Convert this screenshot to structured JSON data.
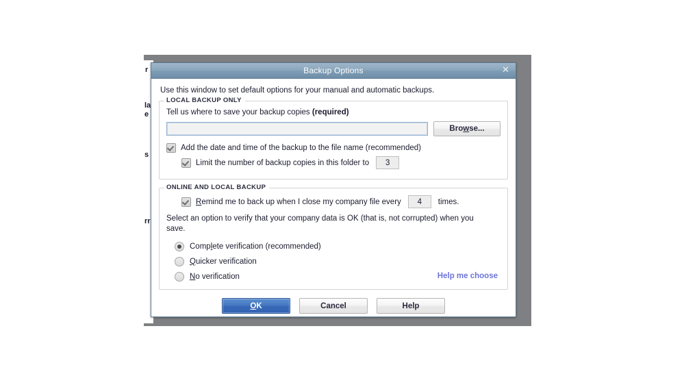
{
  "background_window": {
    "text_fragments": [
      "r",
      "la",
      "e",
      "s",
      "rr"
    ]
  },
  "dialog": {
    "title": "Backup Options",
    "close_icon": "close-icon",
    "intro": "Use this window to set default options for your manual and automatic backups.",
    "local_group": {
      "legend": "LOCAL BACKUP ONLY",
      "prompt_text": "Tell us where to save your backup copies ",
      "prompt_emphasis": "(required)",
      "path_value": "",
      "path_placeholder": "",
      "browse_label_pre": "Bro",
      "browse_label_accel": "w",
      "browse_label_post": "se...",
      "add_date_label": "Add the date and time of the backup to the file name (recommended)",
      "add_date_checked": true,
      "limit_label": "Limit the number of backup copies in this folder to",
      "limit_checked": true,
      "limit_value": "3"
    },
    "online_group": {
      "legend": "ONLINE AND LOCAL BACKUP",
      "remind_checked": true,
      "remind_label_accel": "R",
      "remind_label_rest": "emind me to back up when I close my company file every",
      "remind_value": "4",
      "remind_suffix": "times.",
      "verify_paragraph": "Select an option to verify that your company data is OK (that is, not corrupted) when you save.",
      "options": [
        {
          "label_pre": "Comp",
          "label_accel": "l",
          "label_post": "ete verification (recommended)",
          "selected": true
        },
        {
          "label_pre": "",
          "label_accel": "Q",
          "label_post": "uicker verification",
          "selected": false
        },
        {
          "label_pre": "",
          "label_accel": "N",
          "label_post": "o verification",
          "selected": false
        }
      ],
      "help_link": "Help me choose"
    },
    "footer": {
      "ok_accel": "O",
      "ok_rest": "K",
      "cancel_label": "Cancel",
      "help_label": "Help"
    }
  }
}
